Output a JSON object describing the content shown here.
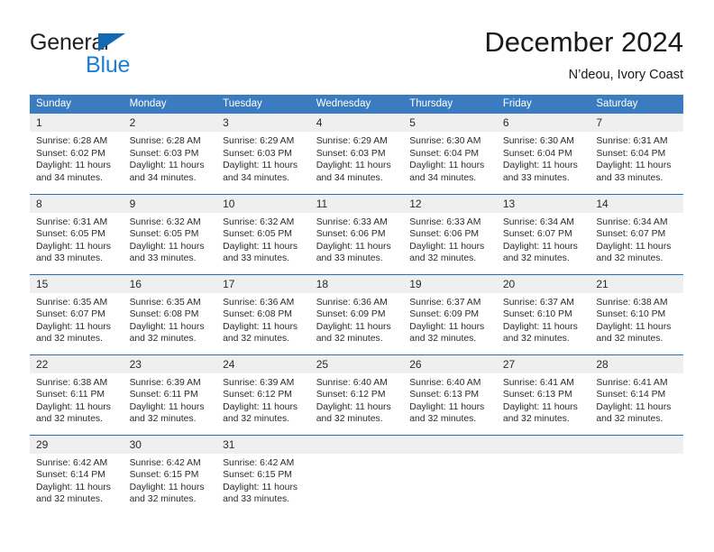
{
  "logo": {
    "text_top": "General",
    "text_bottom": "Blue",
    "triangle_icon": "blue-triangle-icon",
    "color_dark": "#231f20",
    "color_blue": "#1a7fd4"
  },
  "header": {
    "title": "December 2024",
    "subtitle": "N’deou, Ivory Coast"
  },
  "theme": {
    "header_blue": "#3b7cc0",
    "row_divider_blue": "#2c6fb5",
    "daynum_band": "#efeff0",
    "text": "#2b2b2b"
  },
  "calendar": {
    "weekday_headers": [
      "Sunday",
      "Monday",
      "Tuesday",
      "Wednesday",
      "Thursday",
      "Friday",
      "Saturday"
    ],
    "weeks": [
      [
        {
          "day": "1",
          "sunrise": "Sunrise: 6:28 AM",
          "sunset": "Sunset: 6:02 PM",
          "daylight_line1": "Daylight: 11 hours",
          "daylight_line2": "and 34 minutes."
        },
        {
          "day": "2",
          "sunrise": "Sunrise: 6:28 AM",
          "sunset": "Sunset: 6:03 PM",
          "daylight_line1": "Daylight: 11 hours",
          "daylight_line2": "and 34 minutes."
        },
        {
          "day": "3",
          "sunrise": "Sunrise: 6:29 AM",
          "sunset": "Sunset: 6:03 PM",
          "daylight_line1": "Daylight: 11 hours",
          "daylight_line2": "and 34 minutes."
        },
        {
          "day": "4",
          "sunrise": "Sunrise: 6:29 AM",
          "sunset": "Sunset: 6:03 PM",
          "daylight_line1": "Daylight: 11 hours",
          "daylight_line2": "and 34 minutes."
        },
        {
          "day": "5",
          "sunrise": "Sunrise: 6:30 AM",
          "sunset": "Sunset: 6:04 PM",
          "daylight_line1": "Daylight: 11 hours",
          "daylight_line2": "and 34 minutes."
        },
        {
          "day": "6",
          "sunrise": "Sunrise: 6:30 AM",
          "sunset": "Sunset: 6:04 PM",
          "daylight_line1": "Daylight: 11 hours",
          "daylight_line2": "and 33 minutes."
        },
        {
          "day": "7",
          "sunrise": "Sunrise: 6:31 AM",
          "sunset": "Sunset: 6:04 PM",
          "daylight_line1": "Daylight: 11 hours",
          "daylight_line2": "and 33 minutes."
        }
      ],
      [
        {
          "day": "8",
          "sunrise": "Sunrise: 6:31 AM",
          "sunset": "Sunset: 6:05 PM",
          "daylight_line1": "Daylight: 11 hours",
          "daylight_line2": "and 33 minutes."
        },
        {
          "day": "9",
          "sunrise": "Sunrise: 6:32 AM",
          "sunset": "Sunset: 6:05 PM",
          "daylight_line1": "Daylight: 11 hours",
          "daylight_line2": "and 33 minutes."
        },
        {
          "day": "10",
          "sunrise": "Sunrise: 6:32 AM",
          "sunset": "Sunset: 6:05 PM",
          "daylight_line1": "Daylight: 11 hours",
          "daylight_line2": "and 33 minutes."
        },
        {
          "day": "11",
          "sunrise": "Sunrise: 6:33 AM",
          "sunset": "Sunset: 6:06 PM",
          "daylight_line1": "Daylight: 11 hours",
          "daylight_line2": "and 33 minutes."
        },
        {
          "day": "12",
          "sunrise": "Sunrise: 6:33 AM",
          "sunset": "Sunset: 6:06 PM",
          "daylight_line1": "Daylight: 11 hours",
          "daylight_line2": "and 32 minutes."
        },
        {
          "day": "13",
          "sunrise": "Sunrise: 6:34 AM",
          "sunset": "Sunset: 6:07 PM",
          "daylight_line1": "Daylight: 11 hours",
          "daylight_line2": "and 32 minutes."
        },
        {
          "day": "14",
          "sunrise": "Sunrise: 6:34 AM",
          "sunset": "Sunset: 6:07 PM",
          "daylight_line1": "Daylight: 11 hours",
          "daylight_line2": "and 32 minutes."
        }
      ],
      [
        {
          "day": "15",
          "sunrise": "Sunrise: 6:35 AM",
          "sunset": "Sunset: 6:07 PM",
          "daylight_line1": "Daylight: 11 hours",
          "daylight_line2": "and 32 minutes."
        },
        {
          "day": "16",
          "sunrise": "Sunrise: 6:35 AM",
          "sunset": "Sunset: 6:08 PM",
          "daylight_line1": "Daylight: 11 hours",
          "daylight_line2": "and 32 minutes."
        },
        {
          "day": "17",
          "sunrise": "Sunrise: 6:36 AM",
          "sunset": "Sunset: 6:08 PM",
          "daylight_line1": "Daylight: 11 hours",
          "daylight_line2": "and 32 minutes."
        },
        {
          "day": "18",
          "sunrise": "Sunrise: 6:36 AM",
          "sunset": "Sunset: 6:09 PM",
          "daylight_line1": "Daylight: 11 hours",
          "daylight_line2": "and 32 minutes."
        },
        {
          "day": "19",
          "sunrise": "Sunrise: 6:37 AM",
          "sunset": "Sunset: 6:09 PM",
          "daylight_line1": "Daylight: 11 hours",
          "daylight_line2": "and 32 minutes."
        },
        {
          "day": "20",
          "sunrise": "Sunrise: 6:37 AM",
          "sunset": "Sunset: 6:10 PM",
          "daylight_line1": "Daylight: 11 hours",
          "daylight_line2": "and 32 minutes."
        },
        {
          "day": "21",
          "sunrise": "Sunrise: 6:38 AM",
          "sunset": "Sunset: 6:10 PM",
          "daylight_line1": "Daylight: 11 hours",
          "daylight_line2": "and 32 minutes."
        }
      ],
      [
        {
          "day": "22",
          "sunrise": "Sunrise: 6:38 AM",
          "sunset": "Sunset: 6:11 PM",
          "daylight_line1": "Daylight: 11 hours",
          "daylight_line2": "and 32 minutes."
        },
        {
          "day": "23",
          "sunrise": "Sunrise: 6:39 AM",
          "sunset": "Sunset: 6:11 PM",
          "daylight_line1": "Daylight: 11 hours",
          "daylight_line2": "and 32 minutes."
        },
        {
          "day": "24",
          "sunrise": "Sunrise: 6:39 AM",
          "sunset": "Sunset: 6:12 PM",
          "daylight_line1": "Daylight: 11 hours",
          "daylight_line2": "and 32 minutes."
        },
        {
          "day": "25",
          "sunrise": "Sunrise: 6:40 AM",
          "sunset": "Sunset: 6:12 PM",
          "daylight_line1": "Daylight: 11 hours",
          "daylight_line2": "and 32 minutes."
        },
        {
          "day": "26",
          "sunrise": "Sunrise: 6:40 AM",
          "sunset": "Sunset: 6:13 PM",
          "daylight_line1": "Daylight: 11 hours",
          "daylight_line2": "and 32 minutes."
        },
        {
          "day": "27",
          "sunrise": "Sunrise: 6:41 AM",
          "sunset": "Sunset: 6:13 PM",
          "daylight_line1": "Daylight: 11 hours",
          "daylight_line2": "and 32 minutes."
        },
        {
          "day": "28",
          "sunrise": "Sunrise: 6:41 AM",
          "sunset": "Sunset: 6:14 PM",
          "daylight_line1": "Daylight: 11 hours",
          "daylight_line2": "and 32 minutes."
        }
      ],
      [
        {
          "day": "29",
          "sunrise": "Sunrise: 6:42 AM",
          "sunset": "Sunset: 6:14 PM",
          "daylight_line1": "Daylight: 11 hours",
          "daylight_line2": "and 32 minutes."
        },
        {
          "day": "30",
          "sunrise": "Sunrise: 6:42 AM",
          "sunset": "Sunset: 6:15 PM",
          "daylight_line1": "Daylight: 11 hours",
          "daylight_line2": "and 32 minutes."
        },
        {
          "day": "31",
          "sunrise": "Sunrise: 6:42 AM",
          "sunset": "Sunset: 6:15 PM",
          "daylight_line1": "Daylight: 11 hours",
          "daylight_line2": "and 33 minutes."
        },
        {
          "day": "",
          "sunrise": "",
          "sunset": "",
          "daylight_line1": "",
          "daylight_line2": ""
        },
        {
          "day": "",
          "sunrise": "",
          "sunset": "",
          "daylight_line1": "",
          "daylight_line2": ""
        },
        {
          "day": "",
          "sunrise": "",
          "sunset": "",
          "daylight_line1": "",
          "daylight_line2": ""
        },
        {
          "day": "",
          "sunrise": "",
          "sunset": "",
          "daylight_line1": "",
          "daylight_line2": ""
        }
      ]
    ]
  }
}
